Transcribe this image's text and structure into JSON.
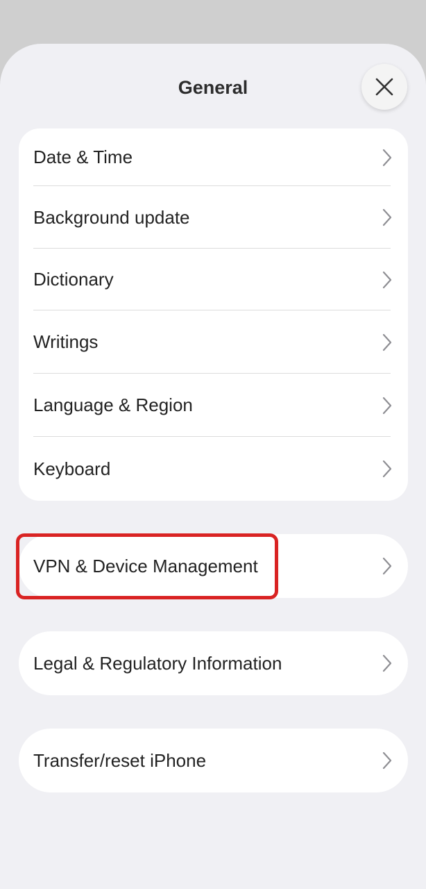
{
  "header": {
    "title": "General"
  },
  "group": {
    "items": [
      {
        "label": "Date & Time"
      },
      {
        "label": "Background update"
      },
      {
        "label": "Dictionary"
      },
      {
        "label": "Writings"
      },
      {
        "label": "Language & Region"
      },
      {
        "label": "Keyboard"
      }
    ]
  },
  "vpn": {
    "label": "VPN & Device Management"
  },
  "legal": {
    "label": "Legal & Regulatory Information"
  },
  "transfer": {
    "label": "Transfer/reset iPhone"
  },
  "colors": {
    "background": "#f0f0f4",
    "highlight": "#d92323",
    "chevron": "#8e8e93"
  },
  "icons": {
    "close": "close-icon",
    "chevron": "chevron-right-icon"
  }
}
